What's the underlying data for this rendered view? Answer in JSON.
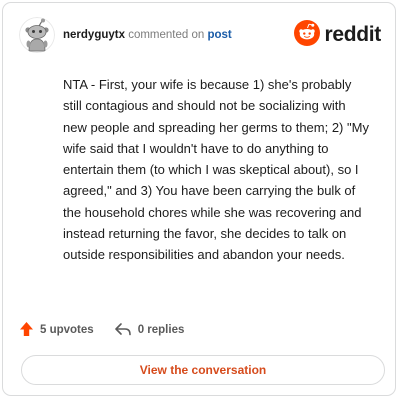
{
  "header": {
    "author": "nerdyguytx",
    "action_text": "commented on",
    "post_link": "post",
    "brand_text": "reddit"
  },
  "comment": {
    "body": "NTA - First, your wife is because 1) she's probably still contagious and should not be socializing with new people and spreading her germs to them; 2) \"My wife said that I wouldn't have to do anything to entertain them (to which I was skeptical about), so I agreed,\" and 3) You have been carrying the bulk of the household chores while she was recovering and instead returning the favor, she decides to talk on outside responsibilities and abandon your needs."
  },
  "footer": {
    "upvotes": "5 upvotes",
    "replies": "0 replies"
  },
  "cta": {
    "label": "View the conversation"
  },
  "icons": {
    "avatar": "snoo-avatar-icon",
    "brand": "reddit-logo-icon",
    "upvote": "upvote-arrow-icon",
    "reply": "reply-arrow-icon"
  },
  "colors": {
    "brand_orange": "#ff4500",
    "upvote_orange": "#ff4500",
    "link_blue": "#1a5ca8",
    "cta_text": "#d64b1c",
    "border": "#dadbdc",
    "text": "#1c1c1c",
    "muted": "#7c7c7c"
  }
}
